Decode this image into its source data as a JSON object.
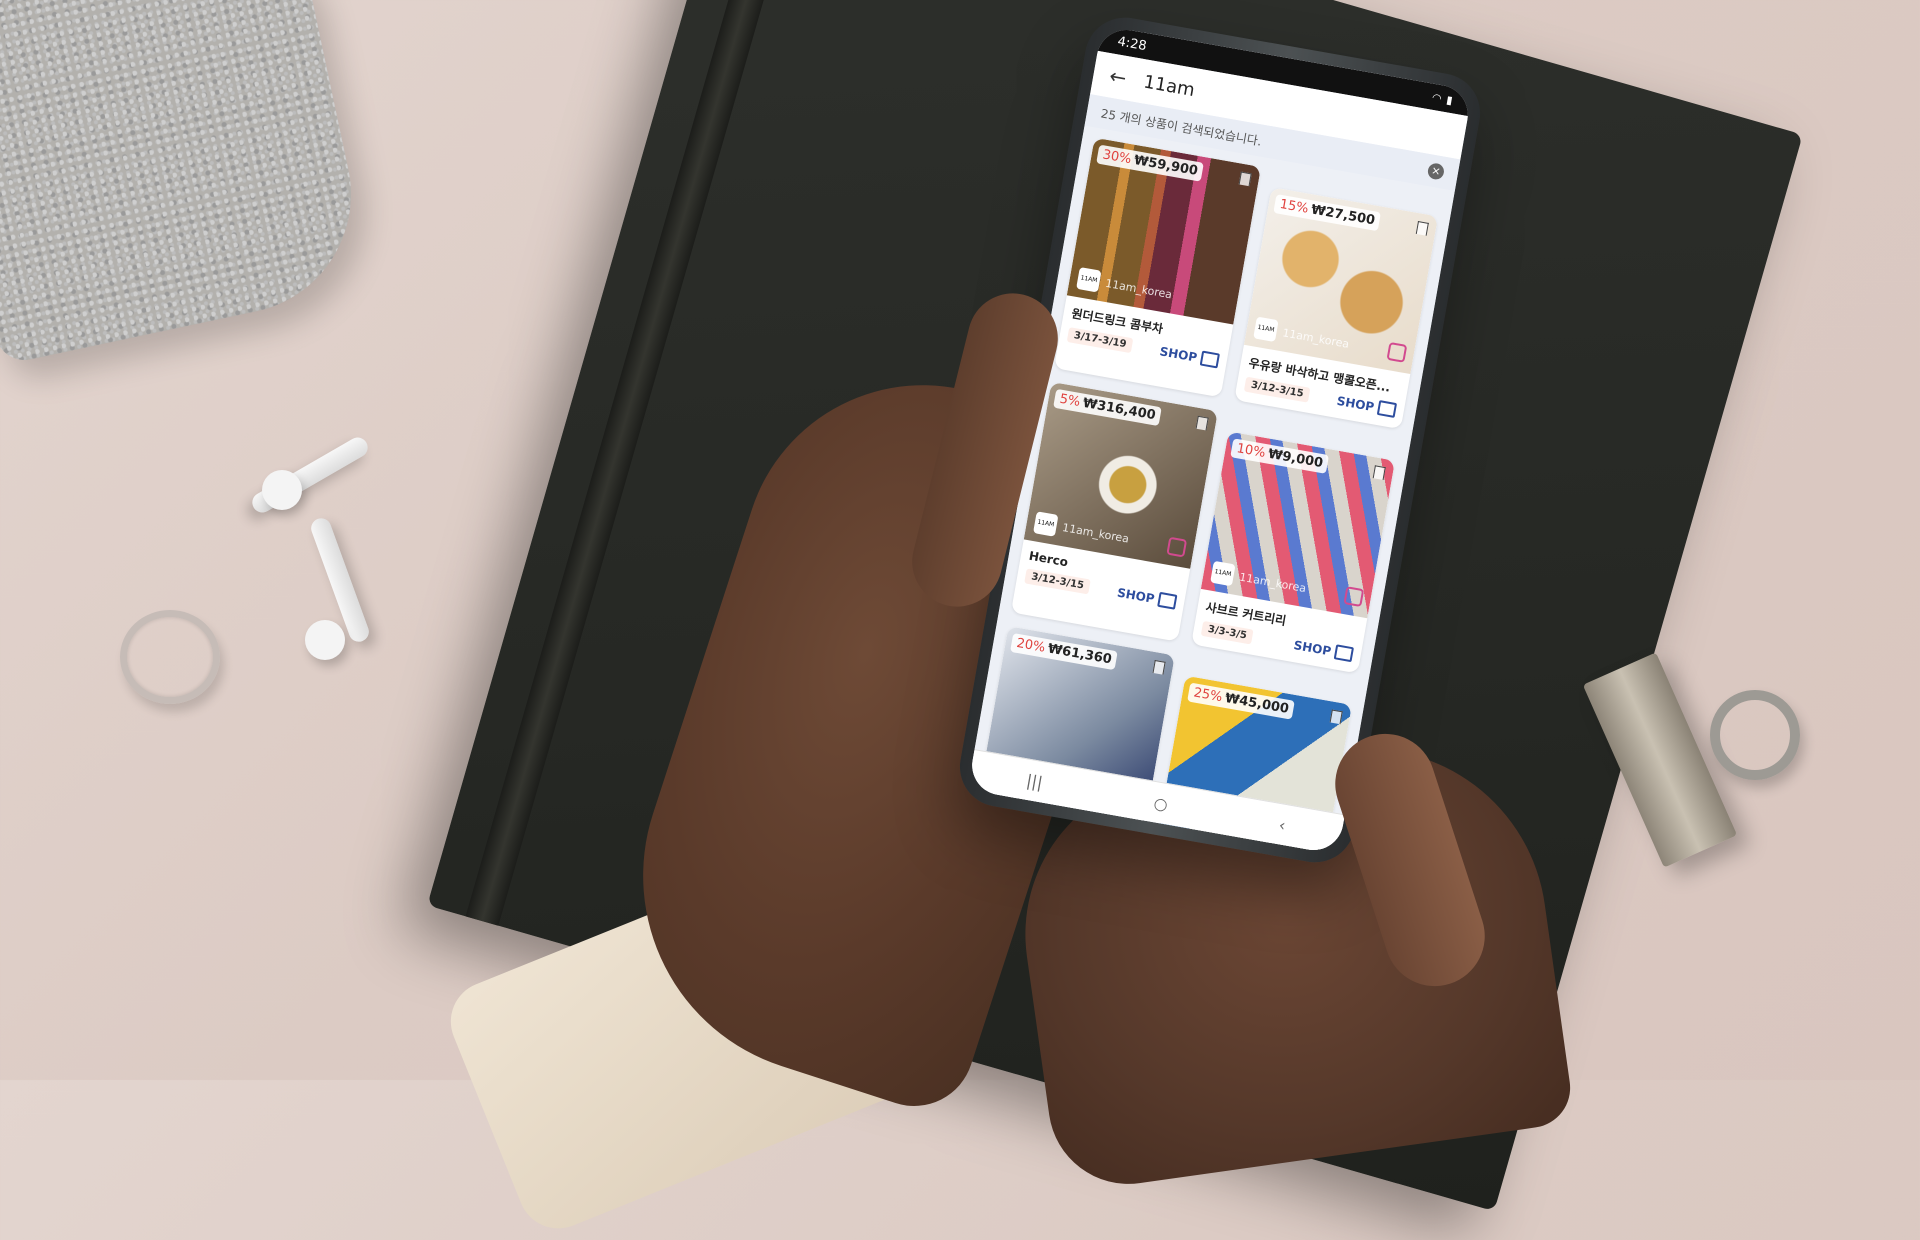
{
  "status_bar": {
    "time": "4:28"
  },
  "app_bar": {
    "title": "11am"
  },
  "results": {
    "summary": "25 개의 상품이 검색되었습니다."
  },
  "products": [
    {
      "discount": "30%",
      "price": "₩59,900",
      "name": "원더드링크 콤부차",
      "dates": "3/17-3/19",
      "brand": "11am_korea",
      "shop": "SHOP"
    },
    {
      "discount": "15%",
      "price": "₩27,500",
      "name": "우유랑 바삭하고 맹콜오픈...",
      "dates": "3/12-3/15",
      "brand": "11am_korea",
      "shop": "SHOP"
    },
    {
      "discount": "5%",
      "price": "₩316,400",
      "name": "Herco",
      "dates": "3/12-3/15",
      "brand": "11am_korea",
      "shop": "SHOP"
    },
    {
      "discount": "10%",
      "price": "₩9,000",
      "name": "사브르 커트리리",
      "dates": "3/3-3/5",
      "brand": "11am_korea",
      "shop": "SHOP"
    },
    {
      "discount": "20%",
      "price": "₩61,360",
      "name": "",
      "dates": "",
      "brand": "",
      "shop": ""
    },
    {
      "discount": "25%",
      "price": "₩45,000",
      "name": "",
      "dates": "",
      "brand": "",
      "shop": ""
    }
  ],
  "brand_logo_text": "11AM",
  "nav": {
    "recent": "|||",
    "home": "○",
    "back": "‹"
  },
  "colors": {
    "discount": "#e0433f",
    "shop_link": "#2d4d9e"
  }
}
